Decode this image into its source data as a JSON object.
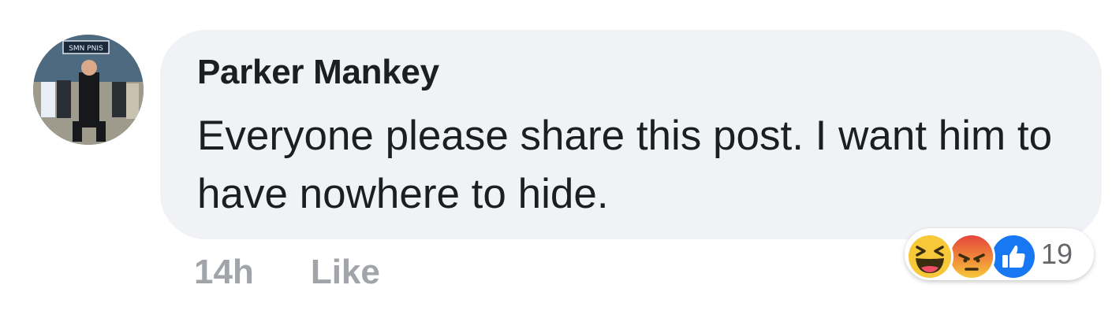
{
  "comment": {
    "author": "Parker Mankey",
    "text": "Everyone please share this post. I want him to have nowhere to hide.",
    "avatar": {
      "sign_text": "SMN PNIS"
    }
  },
  "actions": {
    "timestamp": "14h",
    "like_label": "Like"
  },
  "reactions": {
    "icons": [
      "haha-reaction-icon",
      "angry-reaction-icon",
      "like-reaction-icon"
    ],
    "count": "19"
  },
  "colors": {
    "bubble_background": "#f0f2f5",
    "text": "#1c1e21",
    "muted": "#a1a4a8",
    "like_blue": "#1877f2",
    "haha_yellow": "#f7c83a",
    "angry_red": "#e5463b"
  }
}
